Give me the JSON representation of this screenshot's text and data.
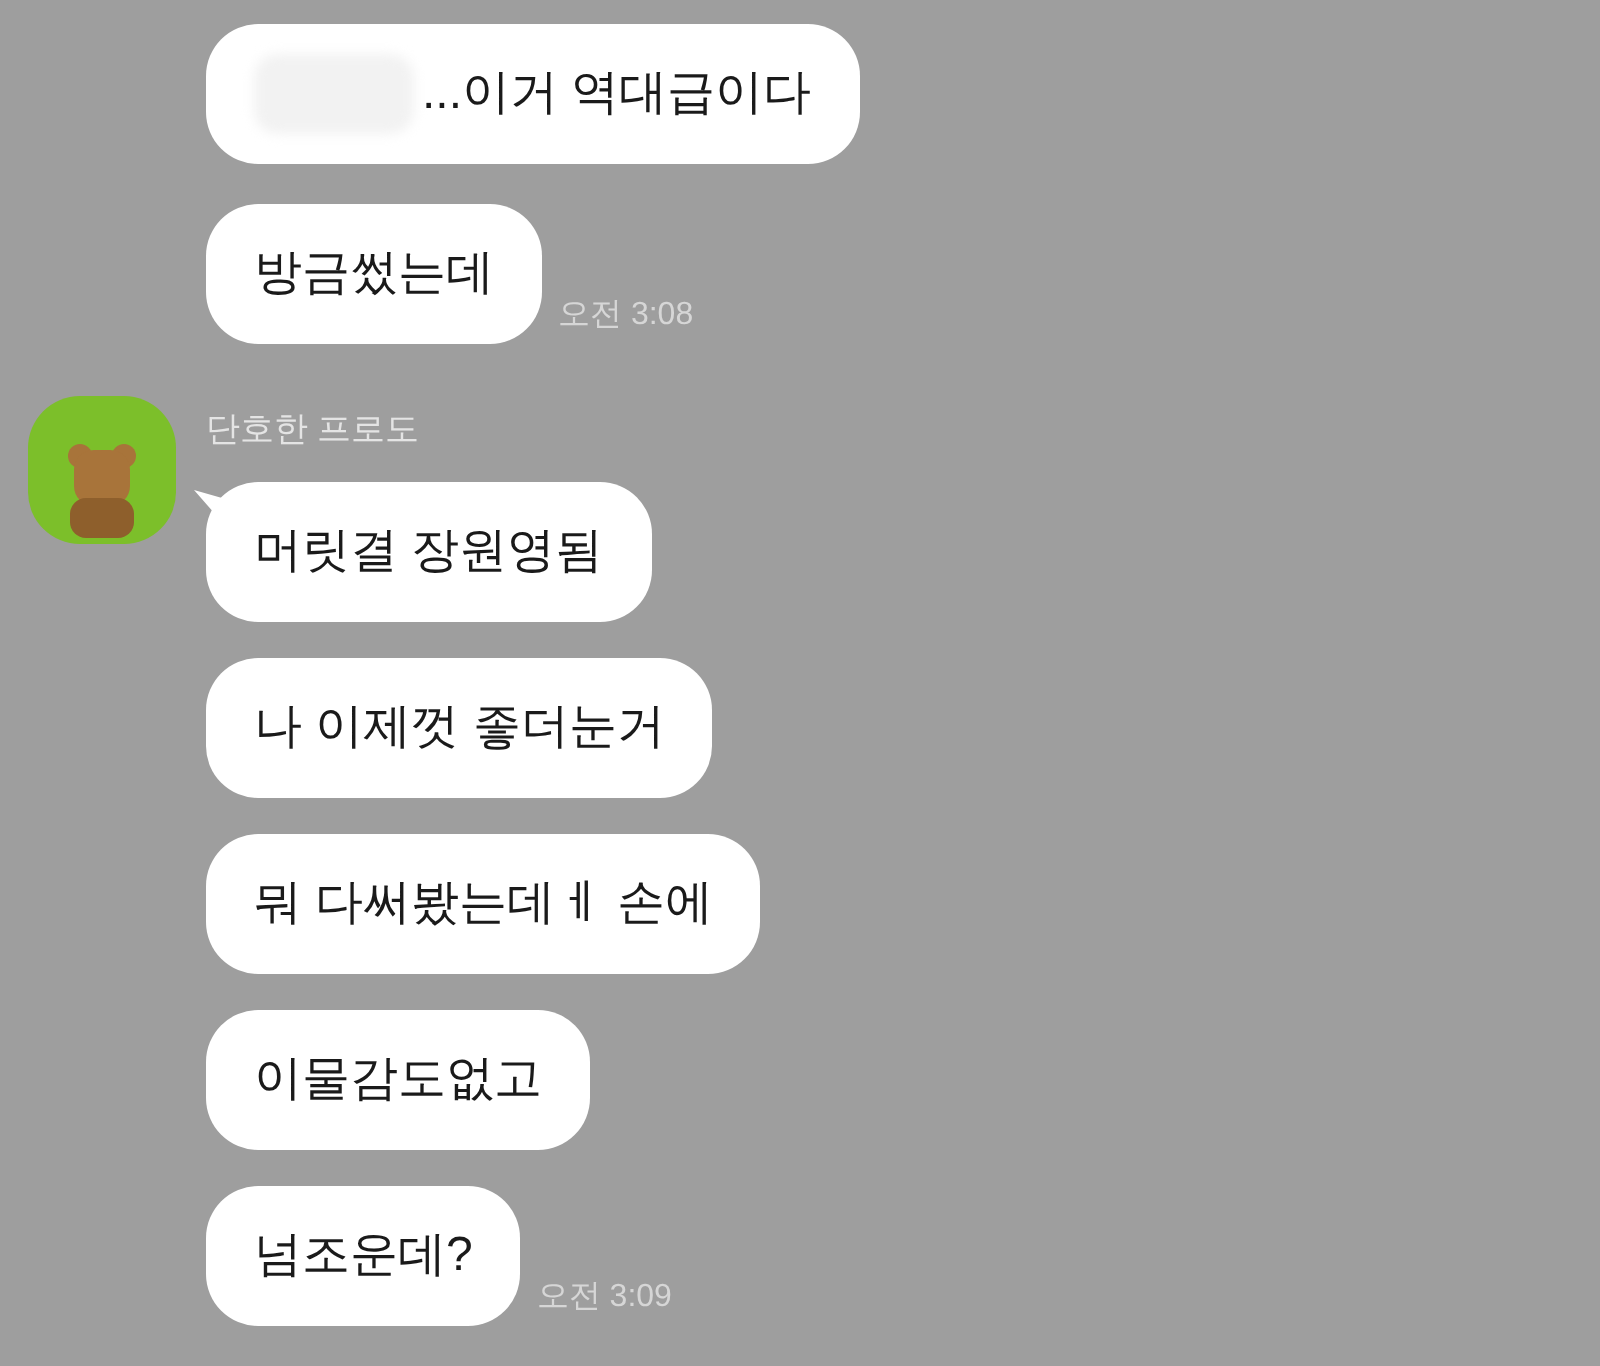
{
  "earlier_messages": [
    {
      "text": "...이거 역대급이다",
      "redacted": true
    },
    {
      "text": "방금썼는데",
      "redacted": false,
      "time": "오전 3:08"
    }
  ],
  "sender": {
    "name": "단호한 프로도"
  },
  "messages": [
    {
      "text": "머릿결 장원영됨"
    },
    {
      "text": "나 이제껏 좋더눈거"
    },
    {
      "text": "뭐 다써봤는데ㅔ 손에"
    },
    {
      "text": "이물감도없고"
    },
    {
      "text": "넘조운데?",
      "time": "오전 3:09"
    }
  ]
}
